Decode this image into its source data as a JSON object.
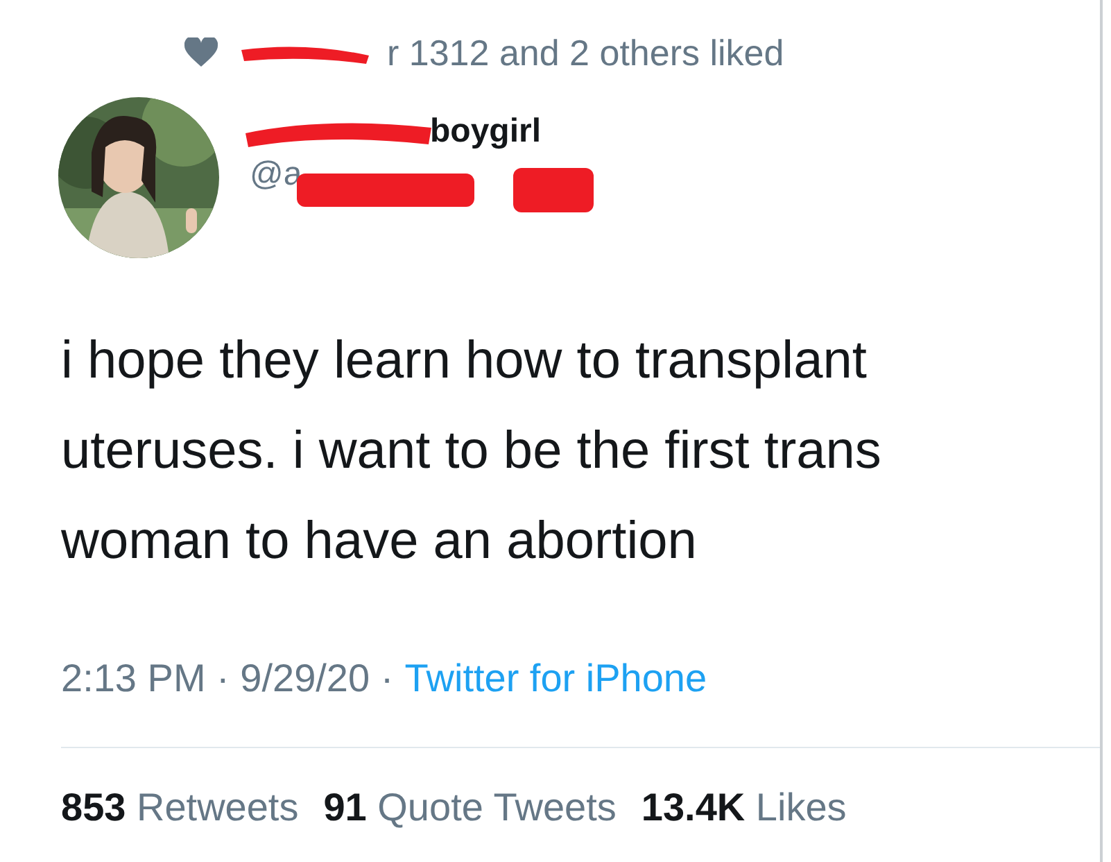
{
  "social_context": {
    "text": "r 1312 and 2 others liked"
  },
  "author": {
    "display_name": "boygirl",
    "handle": "@a"
  },
  "tweet": {
    "text": "i hope they learn how to transplant uteruses. i want to be the first trans woman to have an abortion"
  },
  "meta": {
    "time": "2:13 PM · 9/29/20 ·",
    "source": "Twitter for iPhone"
  },
  "stats": [
    {
      "count": "853",
      "label": "Retweets"
    },
    {
      "count": "91",
      "label": "Quote Tweets"
    },
    {
      "count": "13.4K",
      "label": "Likes"
    }
  ]
}
